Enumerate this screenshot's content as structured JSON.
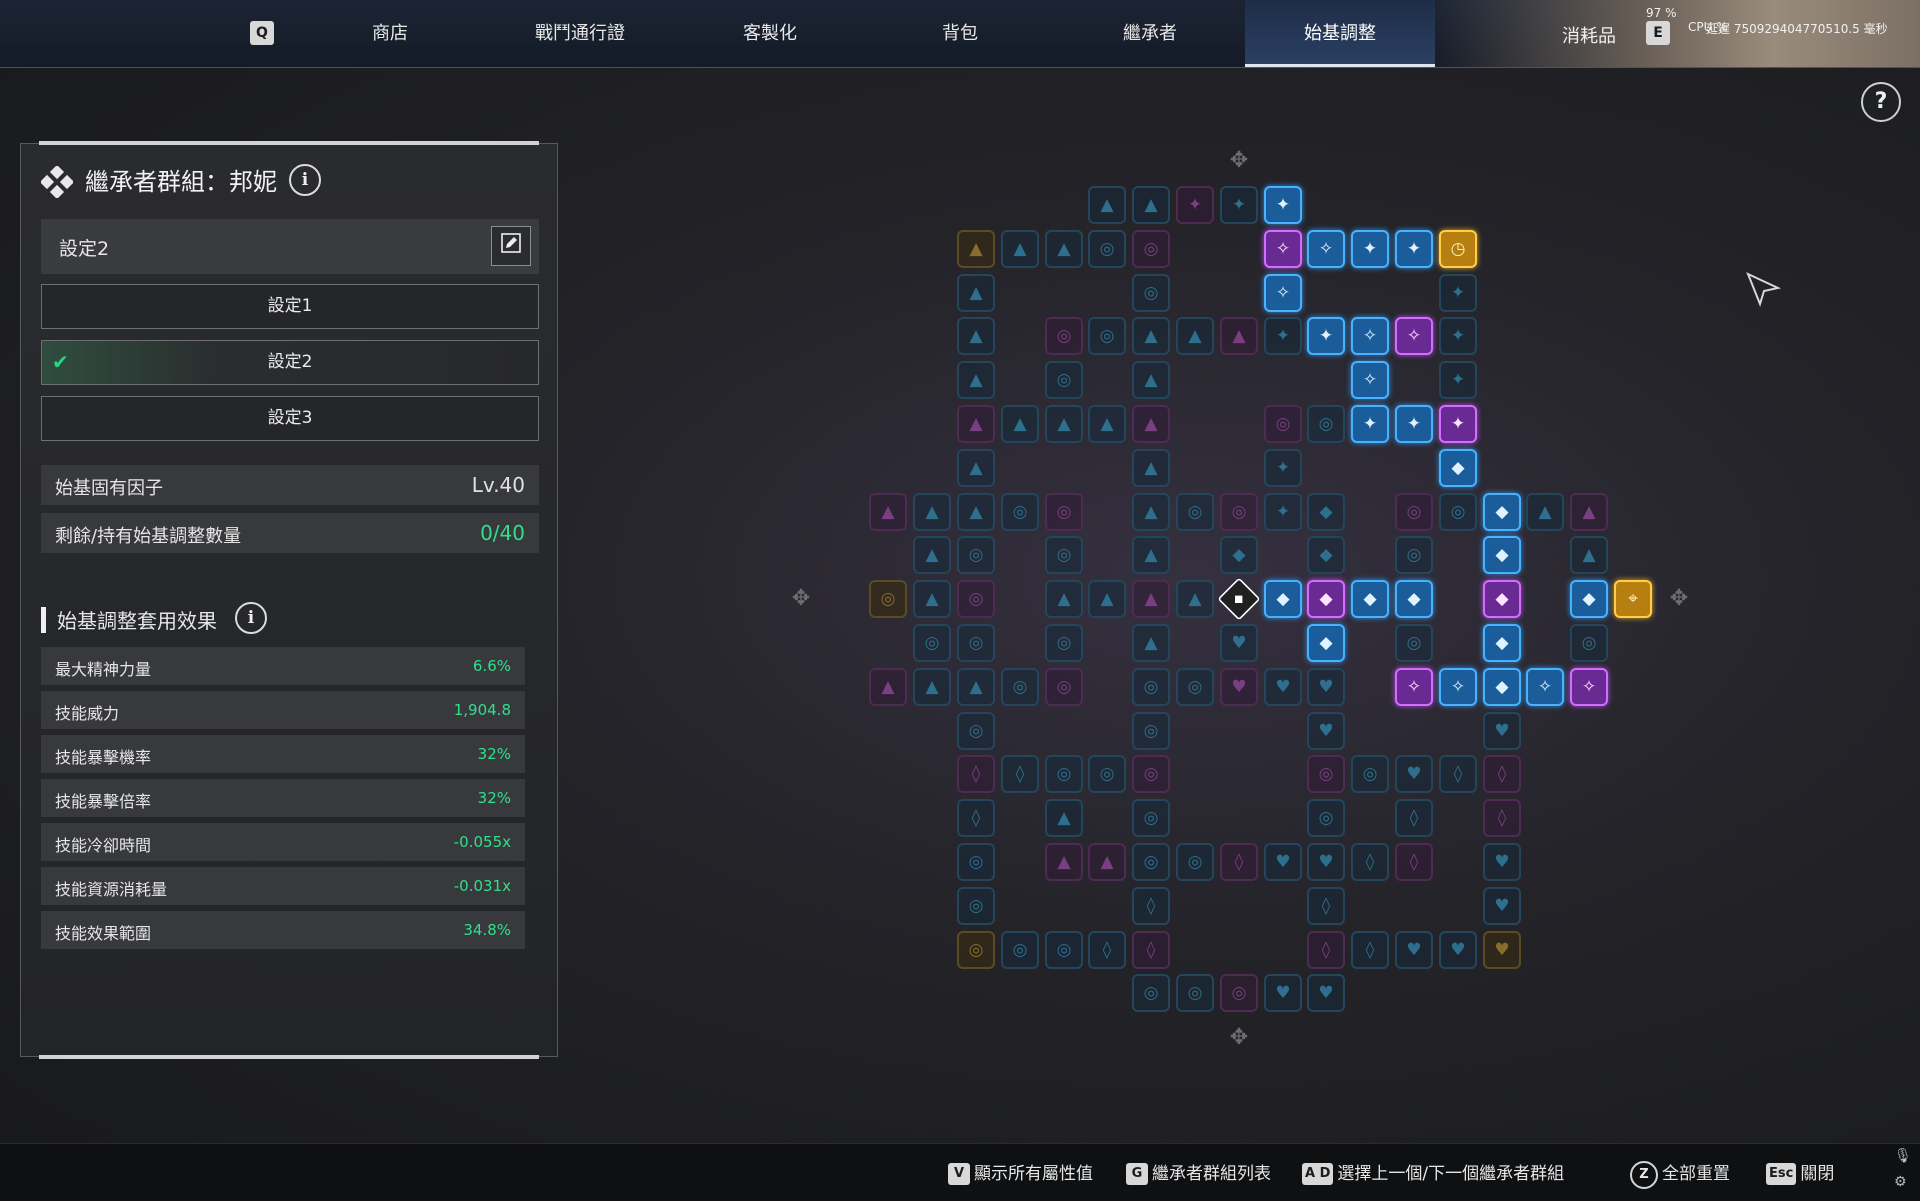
{
  "nav": {
    "left_key": "Q",
    "right_key": "E",
    "tabs": [
      {
        "label": "商店"
      },
      {
        "label": "戰鬥通行證"
      },
      {
        "label": "客製化"
      },
      {
        "label": "背包"
      },
      {
        "label": "繼承者"
      },
      {
        "label": "始基調整",
        "active": true
      },
      {
        "label": "消耗品"
      }
    ]
  },
  "hud": {
    "gpu": "97 %",
    "cpu": "CPU  %",
    "latency": "延遲  750929404770510.5 毫秒"
  },
  "panel": {
    "title": "繼承者群組：邦妮",
    "current_preset": "設定2",
    "presets": [
      {
        "label": "設定1",
        "selected": false
      },
      {
        "label": "設定2",
        "selected": true
      },
      {
        "label": "設定3",
        "selected": false
      }
    ],
    "level_label": "始基固有因子",
    "level_value": "Lv.40",
    "points_label": "剩餘/持有始基調整數量",
    "points_value": "0/40",
    "effects_title": "始基調整套用效果",
    "stats": [
      {
        "label": "最大精神力量",
        "value": "6.6%"
      },
      {
        "label": "技能威力",
        "value": "1,904.8"
      },
      {
        "label": "技能暴擊機率",
        "value": "32%"
      },
      {
        "label": "技能暴擊倍率",
        "value": "32%"
      },
      {
        "label": "技能冷卻時間",
        "value": "-0.055x"
      },
      {
        "label": "技能資源消耗量",
        "value": "-0.031x"
      },
      {
        "label": "技能效果範圍",
        "value": "34.8%"
      }
    ]
  },
  "colors": {
    "accent_green": "#2fe08a",
    "node_blue": "#49b2ff",
    "node_purple": "#d46cff",
    "node_gold": "#ffcf4a"
  },
  "board": {
    "icons": {
      "spike": "▲",
      "star": "✦",
      "diamond": "◆",
      "heart": "♥",
      "shield": "◊",
      "ring": "◎",
      "core": "✧",
      "clock": "◷",
      "compass": "⌖"
    },
    "cells": [
      [
        3,
        0,
        "d-b",
        "spike"
      ],
      [
        4,
        0,
        "d-b",
        "spike"
      ],
      [
        5,
        0,
        "d-p",
        "star"
      ],
      [
        6,
        0,
        "d-b",
        "star"
      ],
      [
        7,
        0,
        "a-b",
        "star"
      ],
      [
        0,
        1,
        "d-g",
        "spike"
      ],
      [
        1,
        1,
        "d-b",
        "spike"
      ],
      [
        2,
        1,
        "d-b",
        "spike"
      ],
      [
        3,
        1,
        "d-b",
        "ring"
      ],
      [
        4,
        1,
        "d-p",
        "ring"
      ],
      [
        7,
        1,
        "a-p",
        "core"
      ],
      [
        8,
        1,
        "a-b",
        "core"
      ],
      [
        9,
        1,
        "a-b",
        "star"
      ],
      [
        10,
        1,
        "a-b",
        "star"
      ],
      [
        11,
        1,
        "a-g",
        "clock"
      ],
      [
        0,
        2,
        "d-b",
        "spike"
      ],
      [
        4,
        2,
        "d-b",
        "ring"
      ],
      [
        7,
        2,
        "a-b",
        "core"
      ],
      [
        11,
        2,
        "d-b",
        "star"
      ],
      [
        0,
        3,
        "d-b",
        "spike"
      ],
      [
        2,
        3,
        "d-p",
        "ring"
      ],
      [
        3,
        3,
        "d-b",
        "ring"
      ],
      [
        4,
        3,
        "d-b",
        "spike"
      ],
      [
        5,
        3,
        "d-b",
        "spike"
      ],
      [
        6,
        3,
        "d-p",
        "spike"
      ],
      [
        7,
        3,
        "d-b",
        "star"
      ],
      [
        8,
        3,
        "a-b",
        "star"
      ],
      [
        9,
        3,
        "a-b",
        "core"
      ],
      [
        10,
        3,
        "a-p",
        "core"
      ],
      [
        11,
        3,
        "d-b",
        "star"
      ],
      [
        0,
        4,
        "d-b",
        "spike"
      ],
      [
        2,
        4,
        "d-b",
        "ring"
      ],
      [
        4,
        4,
        "d-b",
        "spike"
      ],
      [
        9,
        4,
        "a-b",
        "core"
      ],
      [
        11,
        4,
        "d-b",
        "star"
      ],
      [
        0,
        5,
        "d-p",
        "spike"
      ],
      [
        1,
        5,
        "d-b",
        "spike"
      ],
      [
        2,
        5,
        "d-b",
        "spike"
      ],
      [
        3,
        5,
        "d-b",
        "spike"
      ],
      [
        4,
        5,
        "d-p",
        "spike"
      ],
      [
        7,
        5,
        "d-p",
        "ring"
      ],
      [
        8,
        5,
        "d-b",
        "ring"
      ],
      [
        9,
        5,
        "a-b",
        "star"
      ],
      [
        10,
        5,
        "a-b",
        "star"
      ],
      [
        11,
        5,
        "a-p",
        "star"
      ],
      [
        0,
        6,
        "d-b",
        "spike"
      ],
      [
        4,
        6,
        "d-b",
        "spike"
      ],
      [
        7,
        6,
        "d-b",
        "star"
      ],
      [
        11,
        6,
        "a-b",
        "diamond"
      ],
      [
        -2,
        7,
        "d-p",
        "spike"
      ],
      [
        -1,
        7,
        "d-b",
        "spike"
      ],
      [
        0,
        7,
        "d-b",
        "spike"
      ],
      [
        1,
        7,
        "d-b",
        "ring"
      ],
      [
        2,
        7,
        "d-p",
        "ring"
      ],
      [
        4,
        7,
        "d-b",
        "spike"
      ],
      [
        5,
        7,
        "d-b",
        "ring"
      ],
      [
        6,
        7,
        "d-p",
        "ring"
      ],
      [
        7,
        7,
        "d-b",
        "star"
      ],
      [
        8,
        7,
        "d-b",
        "diamond"
      ],
      [
        10,
        7,
        "d-p",
        "ring"
      ],
      [
        11,
        7,
        "d-b",
        "ring"
      ],
      [
        12,
        7,
        "a-b",
        "diamond"
      ],
      [
        13,
        7,
        "d-b",
        "spike"
      ],
      [
        14,
        7,
        "d-p",
        "spike"
      ],
      [
        -1,
        8,
        "d-b",
        "spike"
      ],
      [
        0,
        8,
        "d-b",
        "ring"
      ],
      [
        2,
        8,
        "d-b",
        "ring"
      ],
      [
        4,
        8,
        "d-b",
        "spike"
      ],
      [
        6,
        8,
        "d-b",
        "diamond"
      ],
      [
        8,
        8,
        "d-b",
        "diamond"
      ],
      [
        10,
        8,
        "d-b",
        "ring"
      ],
      [
        12,
        8,
        "a-b",
        "diamond"
      ],
      [
        14,
        8,
        "d-b",
        "spike"
      ],
      [
        -2,
        9,
        "d-g",
        "ring"
      ],
      [
        -1,
        9,
        "d-b",
        "spike"
      ],
      [
        0,
        9,
        "d-p",
        "ring"
      ],
      [
        2,
        9,
        "d-b",
        "spike"
      ],
      [
        3,
        9,
        "d-b",
        "spike"
      ],
      [
        4,
        9,
        "d-p",
        "spike"
      ],
      [
        5,
        9,
        "d-b",
        "spike"
      ],
      [
        6,
        9,
        "a-w",
        "diamond"
      ],
      [
        7,
        9,
        "a-b",
        "diamond"
      ],
      [
        8,
        9,
        "a-p",
        "diamond"
      ],
      [
        9,
        9,
        "a-b",
        "diamond"
      ],
      [
        10,
        9,
        "a-b",
        "diamond"
      ],
      [
        12,
        9,
        "a-p",
        "diamond"
      ],
      [
        14,
        9,
        "a-b",
        "diamond"
      ],
      [
        15,
        9,
        "a-g",
        "compass"
      ],
      [
        -1,
        10,
        "d-b",
        "ring"
      ],
      [
        0,
        10,
        "d-b",
        "ring"
      ],
      [
        2,
        10,
        "d-b",
        "ring"
      ],
      [
        4,
        10,
        "d-b",
        "spike"
      ],
      [
        6,
        10,
        "d-b",
        "heart"
      ],
      [
        8,
        10,
        "a-b",
        "diamond"
      ],
      [
        10,
        10,
        "d-b",
        "ring"
      ],
      [
        12,
        10,
        "a-b",
        "diamond"
      ],
      [
        14,
        10,
        "d-b",
        "ring"
      ],
      [
        -2,
        11,
        "d-p",
        "spike"
      ],
      [
        -1,
        11,
        "d-b",
        "spike"
      ],
      [
        0,
        11,
        "d-b",
        "spike"
      ],
      [
        1,
        11,
        "d-b",
        "ring"
      ],
      [
        2,
        11,
        "d-p",
        "ring"
      ],
      [
        4,
        11,
        "d-b",
        "ring"
      ],
      [
        5,
        11,
        "d-b",
        "ring"
      ],
      [
        6,
        11,
        "d-p",
        "heart"
      ],
      [
        7,
        11,
        "d-b",
        "heart"
      ],
      [
        8,
        11,
        "d-b",
        "heart"
      ],
      [
        10,
        11,
        "a-p",
        "core"
      ],
      [
        11,
        11,
        "a-b",
        "core"
      ],
      [
        12,
        11,
        "a-b",
        "diamond"
      ],
      [
        13,
        11,
        "a-b",
        "core"
      ],
      [
        14,
        11,
        "a-p",
        "core"
      ],
      [
        0,
        12,
        "d-b",
        "ring"
      ],
      [
        4,
        12,
        "d-b",
        "ring"
      ],
      [
        8,
        12,
        "d-b",
        "heart"
      ],
      [
        12,
        12,
        "d-b",
        "heart"
      ],
      [
        0,
        13,
        "d-p",
        "shield"
      ],
      [
        1,
        13,
        "d-b",
        "shield"
      ],
      [
        2,
        13,
        "d-b",
        "ring"
      ],
      [
        3,
        13,
        "d-b",
        "ring"
      ],
      [
        4,
        13,
        "d-p",
        "ring"
      ],
      [
        8,
        13,
        "d-p",
        "ring"
      ],
      [
        9,
        13,
        "d-b",
        "ring"
      ],
      [
        10,
        13,
        "d-b",
        "heart"
      ],
      [
        11,
        13,
        "d-b",
        "shield"
      ],
      [
        12,
        13,
        "d-p",
        "shield"
      ],
      [
        0,
        14,
        "d-b",
        "shield"
      ],
      [
        2,
        14,
        "d-b",
        "spike"
      ],
      [
        4,
        14,
        "d-b",
        "ring"
      ],
      [
        8,
        14,
        "d-b",
        "ring"
      ],
      [
        10,
        14,
        "d-b",
        "shield"
      ],
      [
        12,
        14,
        "d-p",
        "shield"
      ],
      [
        0,
        15,
        "d-b",
        "ring"
      ],
      [
        2,
        15,
        "d-p",
        "spike"
      ],
      [
        3,
        15,
        "d-p",
        "spike"
      ],
      [
        4,
        15,
        "d-b",
        "ring"
      ],
      [
        5,
        15,
        "d-b",
        "ring"
      ],
      [
        6,
        15,
        "d-p",
        "shield"
      ],
      [
        7,
        15,
        "d-b",
        "heart"
      ],
      [
        8,
        15,
        "d-b",
        "heart"
      ],
      [
        9,
        15,
        "d-b",
        "shield"
      ],
      [
        10,
        15,
        "d-p",
        "shield"
      ],
      [
        12,
        15,
        "d-b",
        "heart"
      ],
      [
        0,
        16,
        "d-b",
        "ring"
      ],
      [
        4,
        16,
        "d-b",
        "shield"
      ],
      [
        8,
        16,
        "d-b",
        "shield"
      ],
      [
        12,
        16,
        "d-b",
        "heart"
      ],
      [
        0,
        17,
        "d-g",
        "ring"
      ],
      [
        1,
        17,
        "d-b",
        "ring"
      ],
      [
        2,
        17,
        "d-b",
        "ring"
      ],
      [
        3,
        17,
        "d-b",
        "shield"
      ],
      [
        4,
        17,
        "d-p",
        "shield"
      ],
      [
        8,
        17,
        "d-p",
        "shield"
      ],
      [
        9,
        17,
        "d-b",
        "shield"
      ],
      [
        10,
        17,
        "d-b",
        "heart"
      ],
      [
        11,
        17,
        "d-b",
        "heart"
      ],
      [
        12,
        17,
        "d-g",
        "heart"
      ],
      [
        4,
        18,
        "d-b",
        "ring"
      ],
      [
        5,
        18,
        "d-b",
        "ring"
      ],
      [
        6,
        18,
        "d-p",
        "ring"
      ],
      [
        7,
        18,
        "d-b",
        "heart"
      ],
      [
        8,
        18,
        "d-b",
        "heart"
      ]
    ]
  },
  "footer": {
    "hints": [
      {
        "key": "V",
        "label": "顯示所有屬性值"
      },
      {
        "key": "G",
        "label": "繼承者群組列表"
      },
      {
        "key": "A D",
        "label": "選擇上一個/下一個繼承者群組"
      },
      {
        "key": "Z",
        "label": "全部重置"
      },
      {
        "key": "Esc",
        "label": "關閉"
      }
    ]
  }
}
